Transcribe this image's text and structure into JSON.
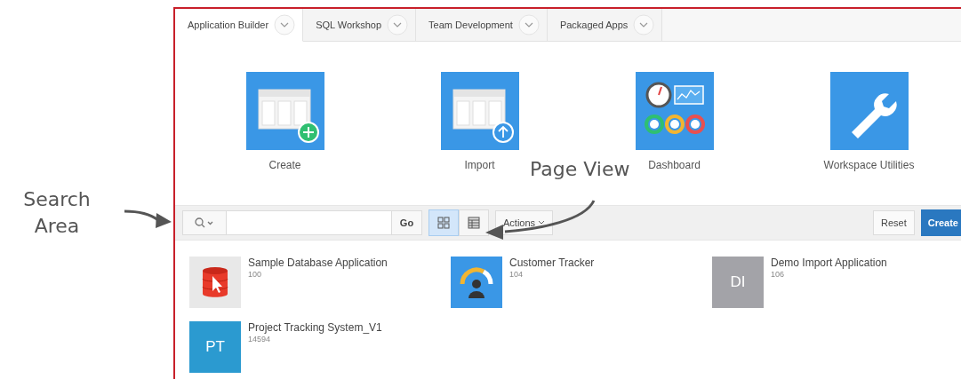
{
  "tabs": [
    {
      "label": "Application Builder",
      "selected": true
    },
    {
      "label": "SQL Workshop",
      "selected": false
    },
    {
      "label": "Team Development",
      "selected": false
    },
    {
      "label": "Packaged Apps",
      "selected": false
    }
  ],
  "tiles": [
    {
      "kind": "create",
      "label": "Create"
    },
    {
      "kind": "import",
      "label": "Import"
    },
    {
      "kind": "dashboard",
      "label": "Dashboard"
    },
    {
      "kind": "utilities",
      "label": "Workspace Utilities"
    }
  ],
  "toolbar": {
    "go": "Go",
    "views": [
      {
        "kind": "grid",
        "selected": true
      },
      {
        "kind": "table",
        "selected": false
      }
    ],
    "actions": "Actions",
    "reset": "Reset",
    "create": "Create"
  },
  "apps": [
    {
      "kind": "database",
      "name": "Sample Database Application",
      "id": "100"
    },
    {
      "kind": "gauge",
      "name": "Customer Tracker",
      "id": "104"
    },
    {
      "kind": "initials",
      "initials": "DI",
      "color": "#a3a3a8",
      "name": "Demo Import Application",
      "id": "106"
    },
    {
      "kind": "initials",
      "initials": "PT",
      "color": "#2b9ad0",
      "name": "Project Tracking System_V1",
      "id": "14594"
    }
  ],
  "annotations": [
    {
      "kind": "search",
      "text": "Search Area"
    },
    {
      "kind": "view",
      "text": "Page View"
    }
  ]
}
